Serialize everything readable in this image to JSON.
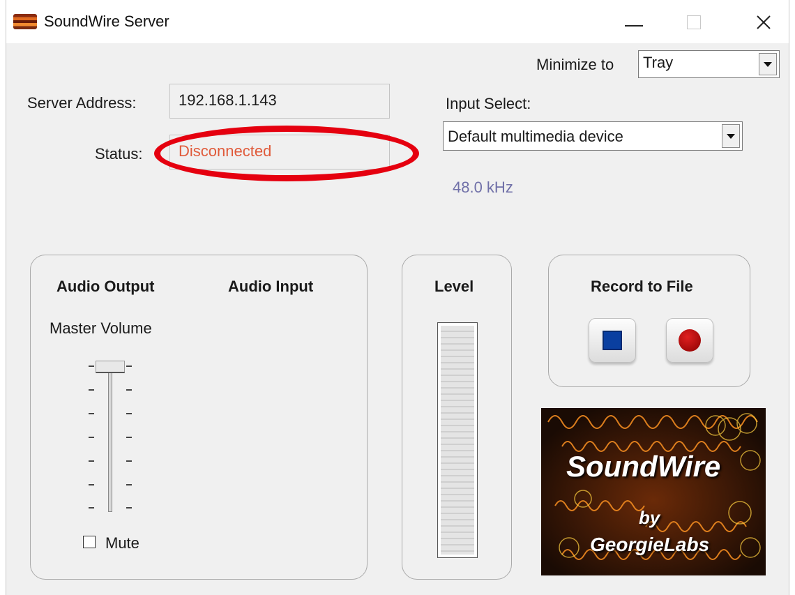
{
  "window": {
    "title": "SoundWire Server"
  },
  "titlebar": {
    "minimize_icon": "minimize-icon",
    "maximize_icon": "maximize-icon",
    "close_icon": "close-icon"
  },
  "minimize_to": {
    "label": "Minimize to",
    "value": "Tray"
  },
  "server": {
    "address_label": "Server Address:",
    "address_value": "192.168.1.143"
  },
  "status": {
    "label": "Status:",
    "value": "Disconnected",
    "value_color": "#e05a3a"
  },
  "input_select": {
    "label": "Input Select:",
    "value": "Default multimedia device",
    "sample_rate": "48.0 kHz"
  },
  "audio_panel": {
    "output_heading": "Audio Output",
    "input_heading": "Audio Input",
    "volume_label": "Master Volume",
    "mute_label": "Mute"
  },
  "level_panel": {
    "heading": "Level"
  },
  "record_panel": {
    "heading": "Record to File",
    "stop_icon": "stop-icon",
    "record_icon": "record-icon"
  },
  "logo": {
    "title": "SoundWire",
    "by": "by",
    "company": "GeorgieLabs"
  },
  "annotation_color": "#e5000f"
}
